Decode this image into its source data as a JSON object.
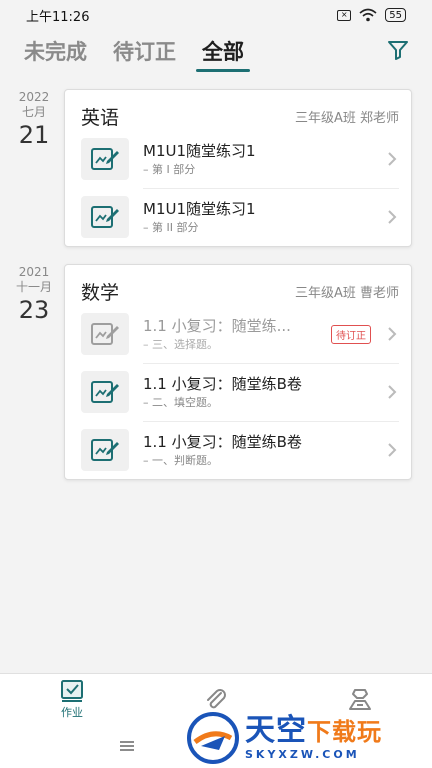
{
  "status_bar": {
    "time": "上午11:26",
    "battery": "55"
  },
  "tabs": [
    {
      "label": "未完成",
      "active": false
    },
    {
      "label": "待订正",
      "active": false
    },
    {
      "label": "全部",
      "active": true
    }
  ],
  "groups": [
    {
      "year": "2022",
      "month": "七月",
      "day": "21",
      "subject": "英语",
      "class_info": "三年级A班  郑老师",
      "items": [
        {
          "title": "M1U1随堂练习1",
          "sub": "– 第 I 部分",
          "dim": false,
          "badge": ""
        },
        {
          "title": "M1U1随堂练习1",
          "sub": "– 第 II 部分",
          "dim": false,
          "badge": ""
        }
      ]
    },
    {
      "year": "2021",
      "month": "十一月",
      "day": "23",
      "subject": "数学",
      "class_info": "三年级A班  曹老师",
      "items": [
        {
          "title": "1.1 小复习：随堂练...",
          "sub": "– 三、选择题。",
          "dim": true,
          "badge": "待订正"
        },
        {
          "title": "1.1 小复习：随堂练B卷",
          "sub": "– 二、填空题。",
          "dim": false,
          "badge": ""
        },
        {
          "title": "1.1 小复习：随堂练B卷",
          "sub": "– 一、判断题。",
          "dim": false,
          "badge": ""
        }
      ]
    }
  ],
  "bottom_nav": {
    "homework_label": "作业"
  },
  "watermark": {
    "cn_main": "天空",
    "cn_accent": "下载玩",
    "en": "SKYXZW.COM"
  },
  "colors": {
    "accent": "#1d6f73",
    "badge": "#e05050",
    "watermark_blue": "#1a54b8",
    "watermark_orange": "#f07a1a"
  },
  "icons": {
    "filter": "funnel-icon",
    "document": "doc-edit-icon",
    "chevron": "chevron-right-icon",
    "nav_homework": "homework-check-icon",
    "nav_attach": "paperclip-icon",
    "nav_profile": "profile-icon",
    "menu": "menu-lines-icon",
    "wifi": "wifi-icon",
    "sim": "sim-icon"
  }
}
